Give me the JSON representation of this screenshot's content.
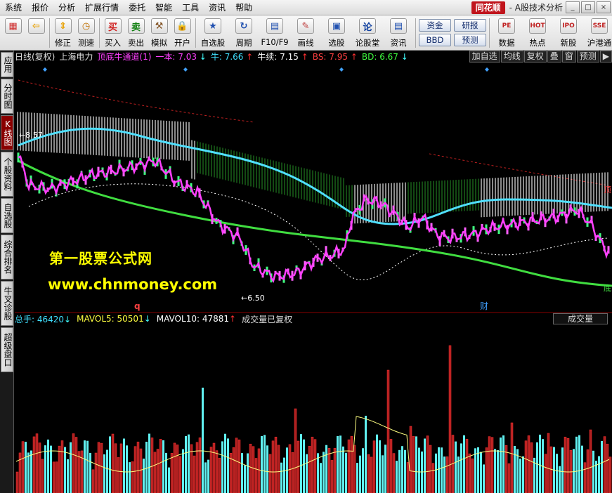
{
  "menu": [
    "系统",
    "报价",
    "分析",
    "扩展行情",
    "委托",
    "智能",
    "工具",
    "资讯",
    "帮助"
  ],
  "brand": {
    "logo": "同花顺",
    "title": "- A股技术分析"
  },
  "window_buttons": [
    "_",
    "□",
    "×"
  ],
  "toolbar": {
    "buttons": [
      {
        "label": "",
        "icon": "windows-icon"
      },
      {
        "label": "",
        "icon": "back-arrow-icon"
      },
      {
        "label": "修正",
        "icon": "up-down-arrow-icon"
      },
      {
        "label": "测速",
        "icon": "clock-icon"
      },
      {
        "label": "买入",
        "icon": "buy-icon",
        "glyph": "买"
      },
      {
        "label": "卖出",
        "icon": "sell-icon",
        "glyph": "卖"
      },
      {
        "label": "模拟",
        "icon": "hammer-icon"
      },
      {
        "label": "开户",
        "icon": "lock-icon"
      },
      {
        "label": "自选股",
        "icon": "star-folder-icon"
      },
      {
        "label": "周期",
        "icon": "cycle-icon"
      },
      {
        "label": "F10/F9",
        "icon": "f10-icon"
      },
      {
        "label": "画线",
        "icon": "pencil-icon"
      },
      {
        "label": "选股",
        "icon": "screen-icon"
      },
      {
        "label": "论股堂",
        "icon": "forum-icon",
        "glyph": "论"
      },
      {
        "label": "资讯",
        "icon": "news-icon"
      }
    ],
    "text_buttons": [
      [
        "资金",
        "BBD"
      ],
      [
        "研报",
        "预测"
      ]
    ],
    "right_buttons": [
      {
        "label": "数据",
        "icon": "pe-icon",
        "glyph": "PE"
      },
      {
        "label": "热点",
        "icon": "hot-icon",
        "glyph": "HOT"
      },
      {
        "label": "新股",
        "icon": "new-stock-icon",
        "glyph": "IPO"
      },
      {
        "label": "沪港通",
        "icon": "hk-connect-icon",
        "glyph": "SSE"
      }
    ]
  },
  "left_tabs": [
    "应用",
    "分时图",
    "K线图",
    "个股资料",
    "自选股",
    "综合排名",
    "牛叉诊股",
    "超级盘口"
  ],
  "chart_header": {
    "period": "日线(复权)",
    "stock": "上海电力",
    "indicator": "顶底牛通道(1)",
    "items": [
      {
        "label": "一本:",
        "value": "7.03",
        "dir": "down",
        "color": "#ff40ff"
      },
      {
        "label": "牛:",
        "value": "7.66",
        "dir": "up",
        "color": "#40e0ff"
      },
      {
        "label": "牛续:",
        "value": "7.15",
        "dir": "up",
        "color": "#ffffff"
      },
      {
        "label": "BS:",
        "value": "7.95",
        "dir": "up",
        "color": "#ff4040"
      },
      {
        "label": "BD:",
        "value": "6.67",
        "dir": "down",
        "color": "#40ff40"
      }
    ],
    "buttons": [
      "加自选",
      "均线",
      "复权",
      "叠",
      "窗",
      "预测",
      "▶"
    ]
  },
  "price_labels": {
    "high": "8.57",
    "low": "6.50"
  },
  "markers": {
    "q": "q",
    "cai": "财"
  },
  "right_edge_labels": [
    "顶",
    "底"
  ],
  "volume_header": {
    "items": [
      {
        "label": "总手:",
        "value": "46420",
        "dir": "down",
        "color": "#40e0ff"
      },
      {
        "label": "MAVOL5:",
        "value": "50501",
        "dir": "down",
        "color": "#ffff40"
      },
      {
        "label": "MAVOL10:",
        "value": "47881",
        "dir": "up",
        "color": "#ffffff"
      },
      {
        "label": "成交量已复权",
        "value": "",
        "dir": "",
        "color": "#dddddd"
      }
    ],
    "button": "成交量"
  },
  "watermark": {
    "line1": "第一股票公式网",
    "line2": "www.chnmoney.com"
  },
  "colors": {
    "up": "#ff3030",
    "down": "#40ffff",
    "ma_cyan": "#50e0ff",
    "ma_green": "#40dd40",
    "channel": "#ff40ff",
    "accent": "#ffff00"
  }
}
